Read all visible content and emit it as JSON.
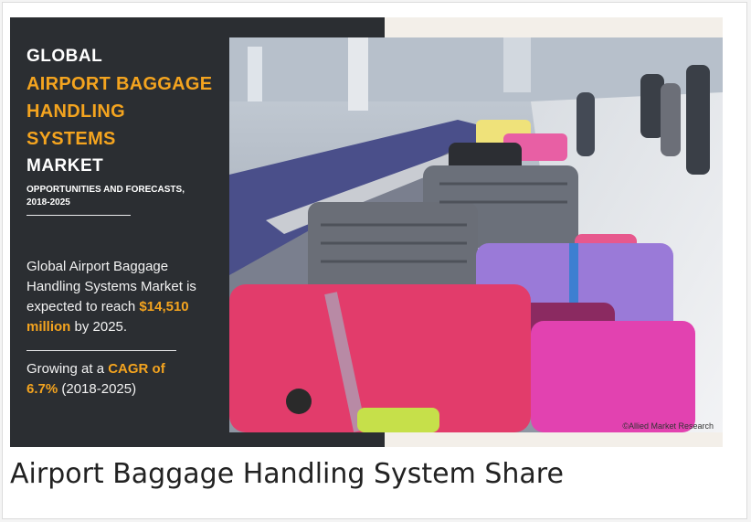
{
  "banner": {
    "title_line1": "GLOBAL",
    "title_line2": "AIRPORT BAGGAGE",
    "title_line3": "HANDLING",
    "title_line4": "SYSTEMS",
    "title_line5": "MARKET",
    "subtitle_line1": "OPPORTUNITIES AND FORECASTS,",
    "subtitle_line2": "2018-2025",
    "stat1_pre": "Global Airport Baggage Handling Systems Market is expected to reach ",
    "stat1_value": "$14,510 million",
    "stat1_post": " by 2025.",
    "stat2_pre": "Growing at a ",
    "stat2_value": "CAGR of 6.7%",
    "stat2_post": " (2018-2025)",
    "credit": "©Allied Market Research",
    "accent_color": "#f4a41f",
    "panel_color": "#2b2e32"
  },
  "caption": "Airport Baggage Handling System Share"
}
